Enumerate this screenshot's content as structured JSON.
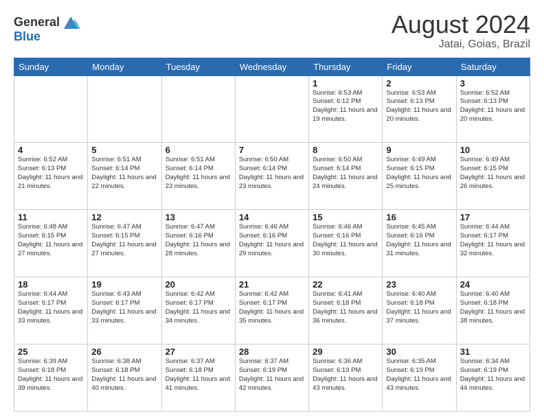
{
  "header": {
    "logo_general": "General",
    "logo_blue": "Blue",
    "month": "August 2024",
    "location": "Jatai, Goias, Brazil"
  },
  "weekdays": [
    "Sunday",
    "Monday",
    "Tuesday",
    "Wednesday",
    "Thursday",
    "Friday",
    "Saturday"
  ],
  "weeks": [
    [
      {
        "day": "",
        "info": ""
      },
      {
        "day": "",
        "info": ""
      },
      {
        "day": "",
        "info": ""
      },
      {
        "day": "",
        "info": ""
      },
      {
        "day": "1",
        "info": "Sunrise: 6:53 AM\nSunset: 6:12 PM\nDaylight: 11 hours and 19 minutes."
      },
      {
        "day": "2",
        "info": "Sunrise: 6:53 AM\nSunset: 6:13 PM\nDaylight: 11 hours and 20 minutes."
      },
      {
        "day": "3",
        "info": "Sunrise: 6:52 AM\nSunset: 6:13 PM\nDaylight: 11 hours and 20 minutes."
      }
    ],
    [
      {
        "day": "4",
        "info": "Sunrise: 6:52 AM\nSunset: 6:13 PM\nDaylight: 11 hours and 21 minutes."
      },
      {
        "day": "5",
        "info": "Sunrise: 6:51 AM\nSunset: 6:14 PM\nDaylight: 11 hours and 22 minutes."
      },
      {
        "day": "6",
        "info": "Sunrise: 6:51 AM\nSunset: 6:14 PM\nDaylight: 11 hours and 23 minutes."
      },
      {
        "day": "7",
        "info": "Sunrise: 6:50 AM\nSunset: 6:14 PM\nDaylight: 11 hours and 23 minutes."
      },
      {
        "day": "8",
        "info": "Sunrise: 6:50 AM\nSunset: 6:14 PM\nDaylight: 11 hours and 24 minutes."
      },
      {
        "day": "9",
        "info": "Sunrise: 6:49 AM\nSunset: 6:15 PM\nDaylight: 11 hours and 25 minutes."
      },
      {
        "day": "10",
        "info": "Sunrise: 6:49 AM\nSunset: 6:15 PM\nDaylight: 11 hours and 26 minutes."
      }
    ],
    [
      {
        "day": "11",
        "info": "Sunrise: 6:48 AM\nSunset: 6:15 PM\nDaylight: 11 hours and 27 minutes."
      },
      {
        "day": "12",
        "info": "Sunrise: 6:47 AM\nSunset: 6:15 PM\nDaylight: 11 hours and 27 minutes."
      },
      {
        "day": "13",
        "info": "Sunrise: 6:47 AM\nSunset: 6:16 PM\nDaylight: 11 hours and 28 minutes."
      },
      {
        "day": "14",
        "info": "Sunrise: 6:46 AM\nSunset: 6:16 PM\nDaylight: 11 hours and 29 minutes."
      },
      {
        "day": "15",
        "info": "Sunrise: 6:46 AM\nSunset: 6:16 PM\nDaylight: 11 hours and 30 minutes."
      },
      {
        "day": "16",
        "info": "Sunrise: 6:45 AM\nSunset: 6:16 PM\nDaylight: 11 hours and 31 minutes."
      },
      {
        "day": "17",
        "info": "Sunrise: 6:44 AM\nSunset: 6:17 PM\nDaylight: 11 hours and 32 minutes."
      }
    ],
    [
      {
        "day": "18",
        "info": "Sunrise: 6:44 AM\nSunset: 6:17 PM\nDaylight: 11 hours and 33 minutes."
      },
      {
        "day": "19",
        "info": "Sunrise: 6:43 AM\nSunset: 6:17 PM\nDaylight: 11 hours and 33 minutes."
      },
      {
        "day": "20",
        "info": "Sunrise: 6:42 AM\nSunset: 6:17 PM\nDaylight: 11 hours and 34 minutes."
      },
      {
        "day": "21",
        "info": "Sunrise: 6:42 AM\nSunset: 6:17 PM\nDaylight: 11 hours and 35 minutes."
      },
      {
        "day": "22",
        "info": "Sunrise: 6:41 AM\nSunset: 6:18 PM\nDaylight: 11 hours and 36 minutes."
      },
      {
        "day": "23",
        "info": "Sunrise: 6:40 AM\nSunset: 6:18 PM\nDaylight: 11 hours and 37 minutes."
      },
      {
        "day": "24",
        "info": "Sunrise: 6:40 AM\nSunset: 6:18 PM\nDaylight: 11 hours and 38 minutes."
      }
    ],
    [
      {
        "day": "25",
        "info": "Sunrise: 6:39 AM\nSunset: 6:18 PM\nDaylight: 11 hours and 39 minutes."
      },
      {
        "day": "26",
        "info": "Sunrise: 6:38 AM\nSunset: 6:18 PM\nDaylight: 11 hours and 40 minutes."
      },
      {
        "day": "27",
        "info": "Sunrise: 6:37 AM\nSunset: 6:18 PM\nDaylight: 11 hours and 41 minutes."
      },
      {
        "day": "28",
        "info": "Sunrise: 6:37 AM\nSunset: 6:19 PM\nDaylight: 11 hours and 42 minutes."
      },
      {
        "day": "29",
        "info": "Sunrise: 6:36 AM\nSunset: 6:19 PM\nDaylight: 11 hours and 43 minutes."
      },
      {
        "day": "30",
        "info": "Sunrise: 6:35 AM\nSunset: 6:19 PM\nDaylight: 11 hours and 43 minutes."
      },
      {
        "day": "31",
        "info": "Sunrise: 6:34 AM\nSunset: 6:19 PM\nDaylight: 11 hours and 44 minutes."
      }
    ]
  ]
}
